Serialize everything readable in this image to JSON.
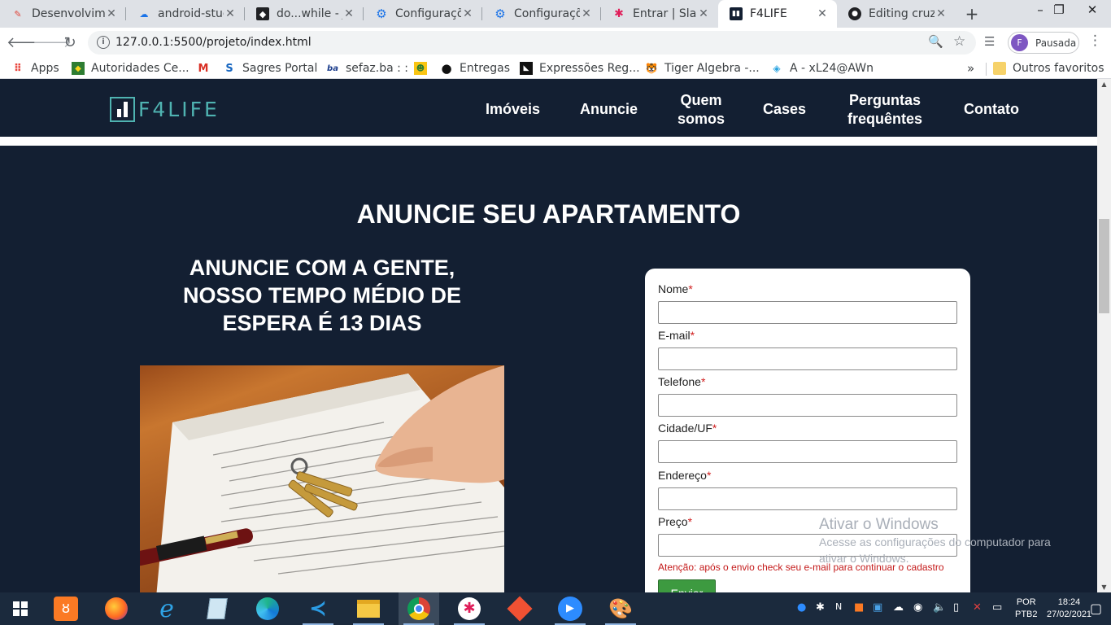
{
  "browser": {
    "tabs": [
      {
        "title": "Desenvolvim",
        "icon": "dev-icon",
        "color": "#e0453a"
      },
      {
        "title": "android-stuc",
        "icon": "cloud-icon",
        "color": "#1a73e8"
      },
      {
        "title": "do...while - J",
        "icon": "github-dark-icon",
        "color": "#202124"
      },
      {
        "title": "Configuraçõ",
        "icon": "gear-icon",
        "color": "#1a73e8"
      },
      {
        "title": "Configuraçõ",
        "icon": "gear-icon",
        "color": "#1a73e8"
      },
      {
        "title": "Entrar | Slac",
        "icon": "slack-icon",
        "color": "#e01e5a"
      },
      {
        "title": "F4LIFE",
        "icon": "f4life-icon",
        "color": "#131f32"
      },
      {
        "title": "Editing cruz",
        "icon": "github-icon",
        "color": "#202124"
      }
    ],
    "new_tab": "+",
    "window_controls": {
      "minimize": "–",
      "maximize": "❐",
      "close": "✕"
    },
    "url": "127.0.0.1:5500/projeto/index.html",
    "profile": {
      "initial": "F",
      "label": "Pausada"
    },
    "bookmarks": [
      {
        "label": "Apps",
        "icon": "apps-grid-icon"
      },
      {
        "label": "Autoridades Ce...",
        "icon": "flag-icon"
      },
      {
        "label": "",
        "icon": "gmail-icon"
      },
      {
        "label": "Sagres Portal",
        "icon": "sagres-icon"
      },
      {
        "label": "sefaz.ba : :",
        "icon": "ba-icon"
      },
      {
        "label": "",
        "icon": "contact-card-icon"
      },
      {
        "label": "Entregas",
        "icon": "circle-icon"
      },
      {
        "label": "Expressões Reg...",
        "icon": "code-icon"
      },
      {
        "label": "Tiger Algebra -...",
        "icon": "tiger-icon"
      },
      {
        "label": "A - xL24@AWn",
        "icon": "cube-icon"
      }
    ],
    "bookmarks_more": "»",
    "other_bookmarks": "Outros favoritos"
  },
  "site": {
    "logo_text": "F4LIFE",
    "nav": [
      {
        "lines": [
          "Imóveis"
        ]
      },
      {
        "lines": [
          "Anuncie"
        ]
      },
      {
        "lines": [
          "Quem",
          "somos"
        ]
      },
      {
        "lines": [
          "Cases"
        ]
      },
      {
        "lines": [
          "Perguntas",
          "frequêntes"
        ]
      },
      {
        "lines": [
          "Contato"
        ]
      }
    ],
    "section_title": "ANUNCIE SEU APARTAMENTO",
    "subtitle": "ANUNCIE COM A GENTE, NOSSO TEMPO MÉDIO DE ESPERA É 13 DIAS",
    "form": {
      "fields": [
        {
          "label": "Nome",
          "value": ""
        },
        {
          "label": "E-mail",
          "value": ""
        },
        {
          "label": "Telefone",
          "value": ""
        },
        {
          "label": "Cidade/UF",
          "value": ""
        },
        {
          "label": "Endereço",
          "value": ""
        },
        {
          "label": "Preço",
          "value": ""
        }
      ],
      "required_marker": "*",
      "warning": "Atenção: após o envio check seu e-mail para continuar o cadastro",
      "submit_label": "Enviar"
    }
  },
  "windows": {
    "activation_title": "Ativar o Windows",
    "activation_text": "Acesse as configurações do computador para ativar o Windows.",
    "language": [
      "POR",
      "PTB2"
    ],
    "time": "18:24",
    "date": "27/02/2021"
  }
}
